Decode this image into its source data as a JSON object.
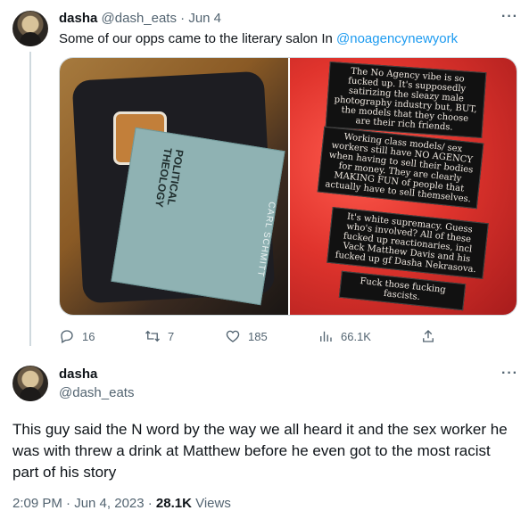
{
  "tweet1": {
    "name": "dasha",
    "handle": "@dash_eats",
    "date": "Jun 4",
    "text_before": "Some of our opps came to the literary salon In ",
    "mention": "@noagencynewyork",
    "book": {
      "title": "POLITICAL\nTHEOLOGY",
      "author": "CARL SCHMITT"
    },
    "sign_panels": [
      "The No Agency vibe is so fucked up. It's supposedly satirizing the sleazy male photography industry but, BUT, the models that they choose are their rich friends.",
      "Working class models/ sex workers still have NO AGENCY when having to sell their bodies for money. They are clearly MAKING FUN of people that actually have to sell themselves.",
      "It's white supremacy. Guess who's involved? All of these fucked up reactionaries, incl Vack Matthew Davis and his fucked up gf Dasha Nekrasova.",
      "Fuck those fucking fascists."
    ],
    "stats": {
      "replies": "16",
      "retweets": "7",
      "likes": "185",
      "views": "66.1K"
    }
  },
  "tweet2": {
    "name": "dasha",
    "handle": "@dash_eats",
    "text": "This guy said the N word by the way we all heard it and the sex worker he was with threw a drink at Matthew before he even got to the most racist part of his story",
    "time": "2:09 PM · Jun 4, 2023 · ",
    "views_count": "28.1K",
    "views_label": " Views"
  },
  "more_label": "···"
}
